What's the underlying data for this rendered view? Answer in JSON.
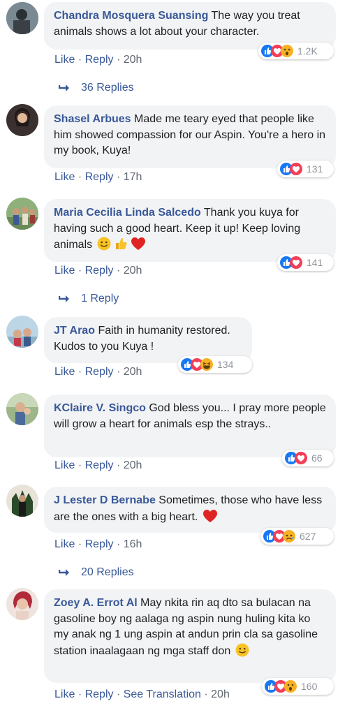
{
  "actions": {
    "like": "Like",
    "reply": "Reply",
    "see_translation": "See Translation",
    "sep": "·"
  },
  "comments": [
    {
      "author": "Chandra Mosquera Suansing",
      "text": "The way you treat animals shows a lot about your character.",
      "time": "20h",
      "reaction_count": "1.2K",
      "reactions": [
        "like-icon",
        "love-icon",
        "wow-icon"
      ],
      "replies": "36 Replies"
    },
    {
      "author": "Shasel Arbues",
      "text": "Made me teary eyed that people like him showed compassion for our Aspin. You're a hero in my book, Kuya!",
      "time": "17h",
      "reaction_count": "131",
      "reactions": [
        "like-icon",
        "love-icon"
      ]
    },
    {
      "author": "Maria Cecilia Linda Salcedo",
      "text": "Thank you kuya for having such a good heart. Keep it up! Keep loving animals",
      "time": "20h",
      "reaction_count": "141",
      "reactions": [
        "like-icon",
        "love-icon"
      ],
      "replies": "1 Reply"
    },
    {
      "author": "JT Arao",
      "text": "Faith in humanity restored. Kudos to you Kuya !",
      "time": "20h",
      "reaction_count": "134",
      "reactions": [
        "like-icon",
        "love-icon",
        "haha-icon"
      ]
    },
    {
      "author": "KClaire V. Singco",
      "text": "God bless you... I pray more people will grow a heart for animals esp the strays..",
      "time": "20h",
      "reaction_count": "66",
      "reactions": [
        "like-icon",
        "love-icon"
      ]
    },
    {
      "author": "J Lester D Bernabe",
      "text": "Sometimes, those who have less are the ones with a big heart.",
      "time": "16h",
      "reaction_count": "627",
      "reactions": [
        "like-icon",
        "love-icon",
        "sad-icon"
      ],
      "replies": "20 Replies"
    },
    {
      "author": "Zoey A. Errot Al",
      "text": "May nkita rin aq dto sa bulacan na gasoline boy ng aalaga ng aspin nung huling kita ko my anak ng 1 ung aspin at andun prin cla sa gasoline station inaalagaan ng mga staff don",
      "time": "20h",
      "reaction_count": "160",
      "reactions": [
        "like-icon",
        "love-icon",
        "wow-icon"
      ]
    }
  ],
  "colors": {
    "link": "#385898",
    "bubble": "#f2f3f5",
    "like": "#1877f2",
    "love": "#f33e58",
    "yellow": "#f7b125"
  }
}
